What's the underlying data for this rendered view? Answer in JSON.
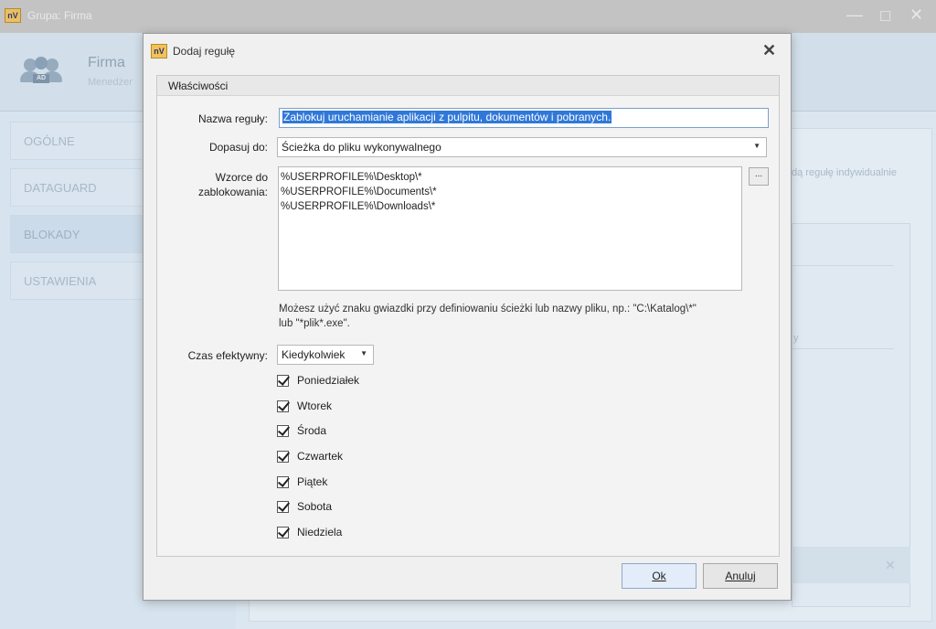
{
  "background_window": {
    "title": "Grupa: Firma",
    "logo": "nV",
    "controls": [
      "—",
      "☐",
      "✕"
    ],
    "header": {
      "name": "Firma",
      "subtitle": "Menedżer",
      "avatar_badge": "AD"
    },
    "sidebar": [
      {
        "label": "OGÓLNE"
      },
      {
        "label": "DATAGUARD"
      },
      {
        "label": "BLOKADY"
      },
      {
        "label": "USTAWIENIA"
      }
    ],
    "hint_fragment": "dą regułę indywidualnie",
    "column_fragment": "y"
  },
  "dialog": {
    "logo": "nV",
    "title": "Dodaj regułę",
    "close_glyph": "✕",
    "group_title": "Właściwości",
    "rule_name_label": "Nazwa reguły:",
    "rule_name_value": "Zablokuj uruchamianie aplikacji z pulpitu, dokumentów i pobranych.",
    "match_label": "Dopasuj do:",
    "match_value": "Ścieżka do pliku wykonywalnego",
    "patterns_label_line1": "Wzorce do",
    "patterns_label_line2": "zablokowania:",
    "patterns": [
      "%USERPROFILE%\\Desktop\\*",
      "%USERPROFILE%\\Documents\\*",
      "%USERPROFILE%\\Downloads\\*"
    ],
    "browse_label": "...",
    "hint_line1": "Możesz użyć znaku gwiazdki przy definiowaniu ścieżki lub nazwy pliku, np.: \"C:\\Katalog\\*\"",
    "hint_line2": "lub \"*plik*.exe\".",
    "effective_time_label": "Czas efektywny:",
    "effective_time_value": "Kiedykolwiek",
    "days": [
      {
        "label": "Poniedziałek",
        "checked": true
      },
      {
        "label": "Wtorek",
        "checked": true
      },
      {
        "label": "Środa",
        "checked": true
      },
      {
        "label": "Czwartek",
        "checked": true
      },
      {
        "label": "Piątek",
        "checked": true
      },
      {
        "label": "Sobota",
        "checked": true
      },
      {
        "label": "Niedziela",
        "checked": true
      }
    ],
    "ok_label": "Ok",
    "cancel_label": "Anuluj"
  }
}
